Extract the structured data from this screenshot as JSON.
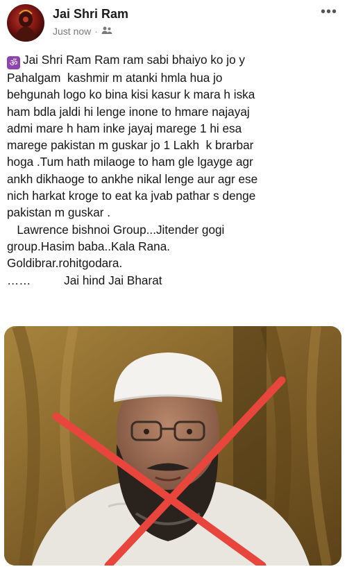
{
  "post": {
    "author": "Jai Shri Ram",
    "timestamp": "Just now",
    "separator": "·",
    "audience_icon": "friends-icon",
    "more_icon": "more-options-icon",
    "om_icon": "om-icon",
    "text_lines": [
      "Jai Shri Ram Ram ram sabi bhaiyo ko jo y",
      "Pahalgam  kashmir m atanki hmla hua jo",
      "behgunah logo ko bina kisi kasur k mara h iska",
      "ham bdla jaldi hi lenge inone to hmare najayaj",
      "admi mare h ham inke jayaj marege 1 hi esa",
      "marege pakistan m guskar jo 1 Lakh  k brarbar",
      "hoga .Tum hath milaoge to ham gle lgayge agr",
      "ankh dikhaoge to ankhe nikal lenge aur agr ese",
      "nich harkat kroge to eat ka jvab pathar s denge",
      "pakistan m guskar .",
      "   Lawrence bishnoi Group...Jitender gogi",
      "group.Hasim baba..Kala Rana.",
      "Goldibrar.rohitgodara.",
      "……          Jai hind Jai Bharat"
    ]
  },
  "colors": {
    "cross": "#e8453c",
    "om_badge": "#8e44ad",
    "background": "#ffffff"
  }
}
